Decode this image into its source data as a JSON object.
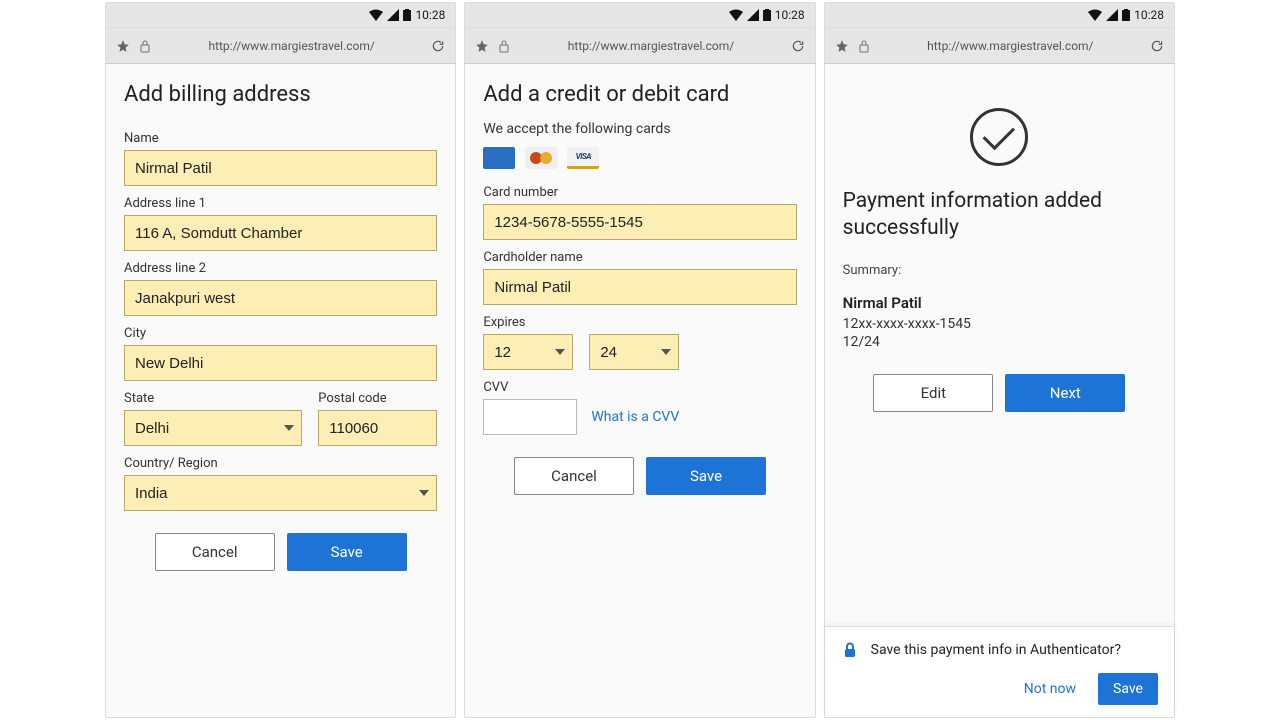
{
  "status": {
    "time": "10:28"
  },
  "urlbar": {
    "url": "http://www.margiestravel.com/"
  },
  "buttons": {
    "cancel": "Cancel",
    "save": "Save",
    "edit": "Edit",
    "next": "Next",
    "not_now": "Not now"
  },
  "billing": {
    "title": "Add billing address",
    "labels": {
      "name": "Name",
      "addr1": "Address line 1",
      "addr2": "Address line 2",
      "city": "City",
      "state": "State",
      "postal": "Postal code",
      "country": "Country/ Region"
    },
    "values": {
      "name": "Nirmal Patil",
      "addr1": "116 A, Somdutt Chamber",
      "addr2": "Janakpuri west",
      "city": "New Delhi",
      "state": "Delhi",
      "postal": "110060",
      "country": "India"
    }
  },
  "card": {
    "title": "Add a credit or debit card",
    "accept_text": "We accept the following cards",
    "labels": {
      "number": "Card number",
      "holder": "Cardholder name",
      "expires": "Expires",
      "cvv": "CVV"
    },
    "values": {
      "number": "1234-5678-5555-1545",
      "holder": "Nirmal Patil",
      "exp_month": "12",
      "exp_year": "24"
    },
    "cvv_link": "What is a CVV"
  },
  "success": {
    "title": "Payment information added successfully",
    "summary_label": "Summary:",
    "name": "Nirmal Patil",
    "masked": "12xx-xxxx-xxxx-1545",
    "exp": "12/24"
  },
  "toast": {
    "text": "Save this payment info in Authenticator?"
  },
  "card_brands": {
    "visa_label": "VISA"
  }
}
